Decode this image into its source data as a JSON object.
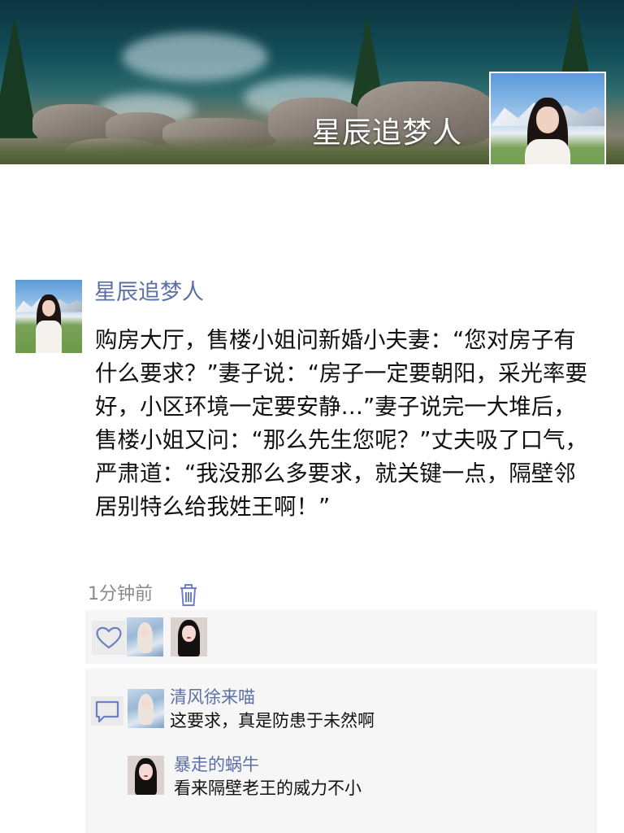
{
  "profile": {
    "cover_name": "星辰追梦人"
  },
  "post": {
    "author": "星辰追梦人",
    "content": "购房大厅，售楼小姐问新婚小夫妻：“您对房子有什么要求？”妻子说：“房子一定要朝阳，采光率要好，小区环境一定要安静…”妻子说完一大堆后，售楼小姐又问：“那么先生您呢？”丈夫吸了口气，严肃道：“我没那么多要求，就关键一点，隔壁邻居别特么给我姓王啊！”",
    "time": "1分钟前",
    "delete_icon": "trash-icon"
  },
  "likes": {
    "icon": "heart-icon",
    "avatars": [
      "liker-1",
      "liker-2"
    ]
  },
  "comments": {
    "icon": "comment-icon",
    "items": [
      {
        "name": "清风徐来喵",
        "text": "这要求，真是防患于未然啊"
      },
      {
        "name": "暴走的蜗牛",
        "text": "看来隔壁老王的威力不小"
      }
    ]
  },
  "colors": {
    "link": "#5b6fa8",
    "time": "#8a8a8a",
    "panel": "#f6f6f6",
    "accent_icon": "#6b80c4"
  }
}
